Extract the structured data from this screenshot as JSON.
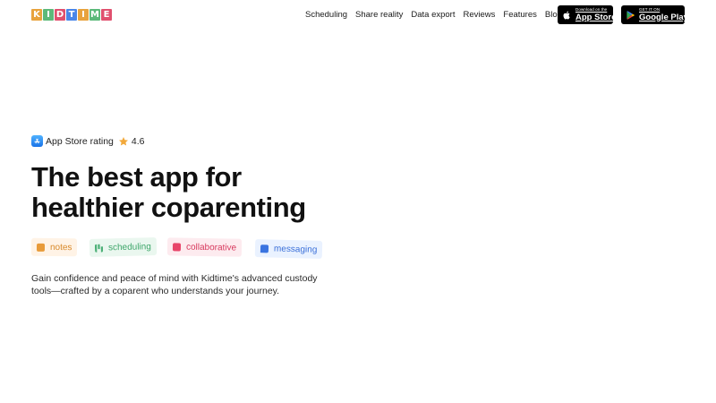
{
  "header": {
    "logo_letters": [
      "K",
      "I",
      "D",
      "T",
      "I",
      "M",
      "E"
    ],
    "logo_colors": [
      "#e8a33d",
      "#5cb97a",
      "#e0506e",
      "#4a86e8",
      "#e8a33d",
      "#5cb97a",
      "#e0506e"
    ],
    "nav": [
      "Scheduling",
      "Share reality",
      "Data export",
      "Reviews",
      "Features",
      "Blog"
    ],
    "app_store": {
      "small": "Download on the",
      "big": "App Store"
    },
    "google_play": {
      "small": "GET IT ON",
      "big": "Google Play"
    }
  },
  "hero": {
    "rating_label": "App Store rating",
    "rating_value": "4.6",
    "headline_line1": "The best app for",
    "headline_line2": "healthier coparenting",
    "tags": [
      {
        "label": "notes",
        "icon": "notes-icon",
        "color": "#d98a2b"
      },
      {
        "label": "scheduling",
        "icon": "scheduling-icon",
        "color": "#3ea66a"
      },
      {
        "label": "collaborative",
        "icon": "calendar-icon",
        "color": "#d83a5e"
      },
      {
        "label": "messaging",
        "icon": "chat-bubble-icon",
        "color": "#3a6fd8"
      }
    ],
    "description": "Gain confidence and peace of mind with Kidtime's advanced custody tools—crafted by a coparent who understands your journey."
  },
  "colors": {
    "background": "#ffffff",
    "text": "#111111",
    "star": "#f2a93b"
  }
}
